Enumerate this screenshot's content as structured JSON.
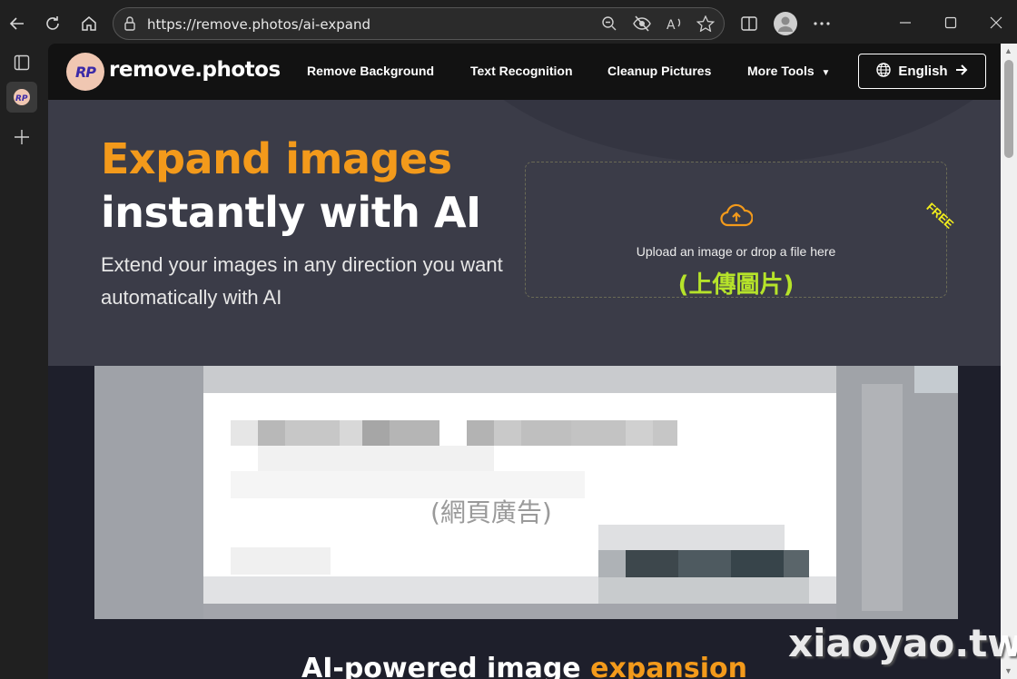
{
  "browser": {
    "url": "https://remove.photos/ai-expand"
  },
  "site": {
    "logo_badge": "RP",
    "logo_text": "remove.photos",
    "nav": [
      "Remove Background",
      "Text Recognition",
      "Cleanup Pictures",
      "More Tools"
    ],
    "language_button": "English"
  },
  "hero": {
    "title_accent": "Expand images",
    "title_rest": "instantly with AI",
    "subtitle": "Extend your images in any direction you want automatically with AI",
    "upload_text": "Upload an image or drop a file here",
    "upload_note": "(上傳圖片)",
    "free_badge": "FREE"
  },
  "ad": {
    "label": "(網頁廣告)"
  },
  "section": {
    "title_start": "AI-powered image ",
    "title_accent": "expansion"
  },
  "watermark": "xiaoyao.tw",
  "colors": {
    "accent_orange": "#f39a1b",
    "note_green": "#b6e32a",
    "free_yellow": "#f3ee1b"
  }
}
